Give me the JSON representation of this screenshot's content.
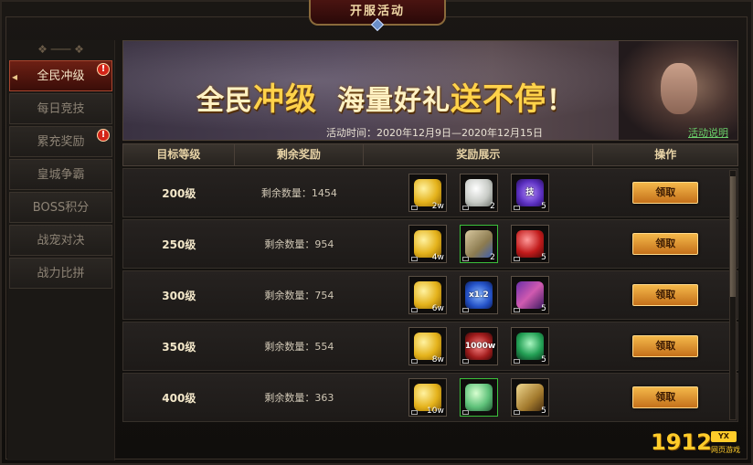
{
  "window": {
    "title": "开服活动"
  },
  "sidebar": {
    "items": [
      {
        "label": "全民冲级",
        "active": true,
        "badge": "!"
      },
      {
        "label": "每日竞技",
        "active": false,
        "badge": ""
      },
      {
        "label": "累充奖励",
        "active": false,
        "badge": "!"
      },
      {
        "label": "皇城争霸",
        "active": false,
        "badge": ""
      },
      {
        "label": "BOSS积分",
        "active": false,
        "badge": ""
      },
      {
        "label": "战宠对决",
        "active": false,
        "badge": ""
      },
      {
        "label": "战力比拼",
        "active": false,
        "badge": ""
      }
    ]
  },
  "banner": {
    "title_part1": "全民",
    "title_part1_big": "冲级",
    "title_part2": "海量好礼",
    "title_part2_big": "送不停",
    "title_end": "！",
    "time_text": "活动时间：2020年12月9日—2020年12月15日",
    "info_link": "活动说明"
  },
  "table": {
    "headers": {
      "level": "目标等级",
      "remaining": "剩余奖励",
      "rewards": "奖励展示",
      "action": "操作"
    },
    "rows": [
      {
        "level": "200级",
        "remaining": "剩余数量：1454",
        "button": "领取",
        "rewards": [
          {
            "icon": "gold-ingot-icon",
            "qty": "2w"
          },
          {
            "icon": "white-egg-icon",
            "qty": "2"
          },
          {
            "icon": "skill-orb-icon",
            "qty": "5",
            "text": "技"
          }
        ]
      },
      {
        "level": "250级",
        "remaining": "剩余数量：954",
        "button": "领取",
        "rewards": [
          {
            "icon": "gold-ingot-icon",
            "qty": "4w"
          },
          {
            "icon": "book-icon",
            "qty": "2"
          },
          {
            "icon": "red-orb-icon",
            "qty": "5"
          }
        ]
      },
      {
        "level": "300级",
        "remaining": "剩余数量：754",
        "button": "领取",
        "rewards": [
          {
            "icon": "gold-ingot-icon",
            "qty": "6w"
          },
          {
            "icon": "multiplier-icon",
            "qty": "",
            "text": "x1.2"
          },
          {
            "icon": "weapon-icon",
            "qty": "5"
          }
        ]
      },
      {
        "level": "350级",
        "remaining": "剩余数量：554",
        "button": "领取",
        "rewards": [
          {
            "icon": "gold-ingot-icon",
            "qty": "8w"
          },
          {
            "icon": "coin-icon",
            "qty": "",
            "text": "1000w"
          },
          {
            "icon": "jade-icon",
            "qty": "5"
          }
        ]
      },
      {
        "level": "400级",
        "remaining": "剩余数量：363",
        "button": "领取",
        "rewards": [
          {
            "icon": "gold-ingot-icon",
            "qty": "10w"
          },
          {
            "icon": "green-egg-icon",
            "qty": ""
          },
          {
            "icon": "scroll-icon",
            "qty": "5"
          }
        ]
      }
    ]
  },
  "logo": {
    "number": "1912",
    "badge": "YX",
    "subtitle": "网页游戏"
  }
}
